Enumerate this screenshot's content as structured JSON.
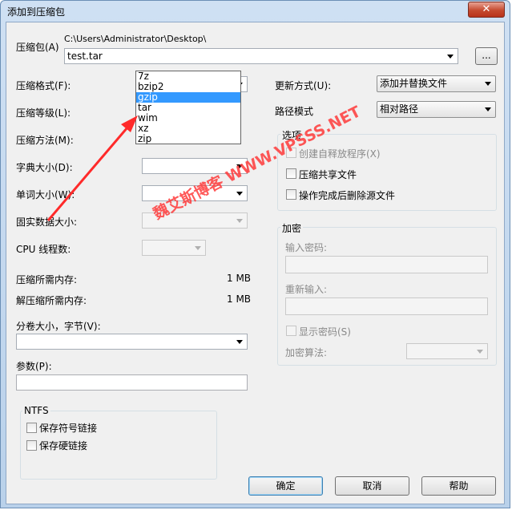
{
  "window": {
    "title": "添加到压缩包",
    "close_glyph": "✕"
  },
  "archive": {
    "label": "压缩包(A)",
    "path": "C:\\Users\\Administrator\\Desktop\\",
    "value": "test.tar",
    "browse": "..."
  },
  "left": {
    "format_label": "压缩格式(F):",
    "format_value": "tar",
    "format_options": [
      "7z",
      "bzip2",
      "gzip",
      "tar",
      "wim",
      "xz",
      "zip"
    ],
    "format_selected_index": 2,
    "level_label": "压缩等级(L):",
    "method_label": "压缩方法(M):",
    "dict_label": "字典大小(D):",
    "word_label": "单词大小(W):",
    "solid_label": "固实数据大小:",
    "cpu_label": "CPU 线程数:",
    "mem_label": "压缩所需内存:",
    "mem_value": "1 MB",
    "dmem_label": "解压缩所需内存:",
    "dmem_value": "1 MB",
    "split_label": "分卷大小，字节(V):",
    "params_label": "参数(P):"
  },
  "ntfs": {
    "title": "NTFS",
    "symlinks": "保存符号链接",
    "hardlinks": "保存硬链接"
  },
  "right": {
    "update_label": "更新方式(U):",
    "update_value": "添加并替换文件",
    "path_label": "路径模式",
    "path_value": "相对路径",
    "options_title": "选项",
    "opt_sfx": "创建自释放程序(X)",
    "opt_shared": "压缩共享文件",
    "opt_delete": "操作完成后删除源文件",
    "enc_title": "加密",
    "enc_password": "输入密码:",
    "enc_reenter": "重新输入:",
    "enc_show": "显示密码(S)",
    "enc_method": "加密算法:"
  },
  "buttons": {
    "ok": "确定",
    "cancel": "取消",
    "help": "帮助"
  },
  "watermark": "魏艾斯博客 WWW.VPSSS.NET",
  "colors": {
    "accent": "#3399ff",
    "annotation": "#ff2a2a"
  }
}
